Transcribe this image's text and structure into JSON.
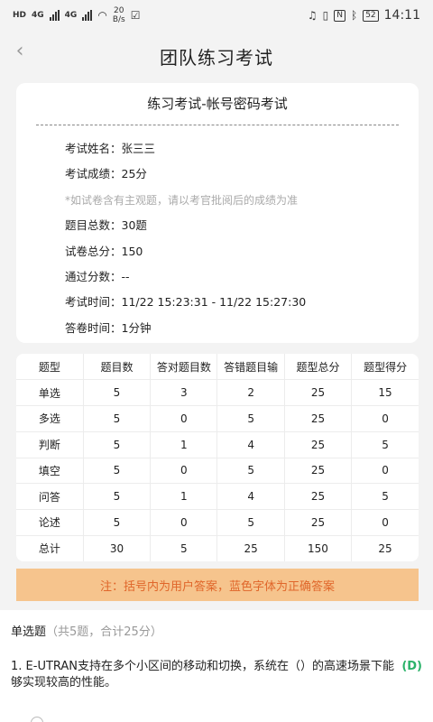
{
  "status_bar": {
    "net1": "HD",
    "net2": "4G",
    "net3": "4G",
    "speed_value": "20",
    "speed_unit": "B/s",
    "nfc": "N",
    "battery": "52",
    "time": "14:11"
  },
  "nav": {
    "back_glyph": "‹",
    "title": "团队练习考试"
  },
  "exam": {
    "title": "练习考试-帐号密码考试",
    "rows": [
      {
        "label": "考试姓名：",
        "value": "张三三"
      },
      {
        "label": "考试成绩：",
        "value": "25分"
      },
      {
        "note": "*如试卷含有主观题，请以考官批阅后的成绩为准"
      },
      {
        "label": "题目总数：",
        "value": "30题"
      },
      {
        "label": "试卷总分：",
        "value": "150"
      },
      {
        "label": "通过分数：",
        "value": "--"
      },
      {
        "label": "考试时间：",
        "value": "11/22 15:23:31 - 11/22 15:27:30"
      },
      {
        "label": "答卷时间：",
        "value": "1分钟"
      }
    ]
  },
  "score_table": {
    "headers": [
      "题型",
      "题目数",
      "答对题目数",
      "答错题目输",
      "题型总分",
      "题型得分"
    ],
    "rows": [
      [
        "单选",
        "5",
        "3",
        "2",
        "25",
        "15"
      ],
      [
        "多选",
        "5",
        "0",
        "5",
        "25",
        "0"
      ],
      [
        "判断",
        "5",
        "1",
        "4",
        "25",
        "5"
      ],
      [
        "填空",
        "5",
        "0",
        "5",
        "25",
        "0"
      ],
      [
        "问答",
        "5",
        "1",
        "4",
        "25",
        "5"
      ],
      [
        "论述",
        "5",
        "0",
        "5",
        "25",
        "0"
      ],
      [
        "总计",
        "30",
        "5",
        "25",
        "150",
        "25"
      ]
    ]
  },
  "notice": "注：括号内为用户答案，蓝色字体为正确答案",
  "section": {
    "label": "单选题",
    "meta": "（共5题，合计25分）"
  },
  "question": {
    "text": "1. E-UTRAN支持在多个小区间的移动和切换，系统在（）的高速场景下能够实现较高的性能。",
    "answer": "(D)"
  },
  "colors": {
    "accent_answer": "#2bb36a",
    "notice_bg": "#f6c48d",
    "notice_text": "#e0662a"
  }
}
